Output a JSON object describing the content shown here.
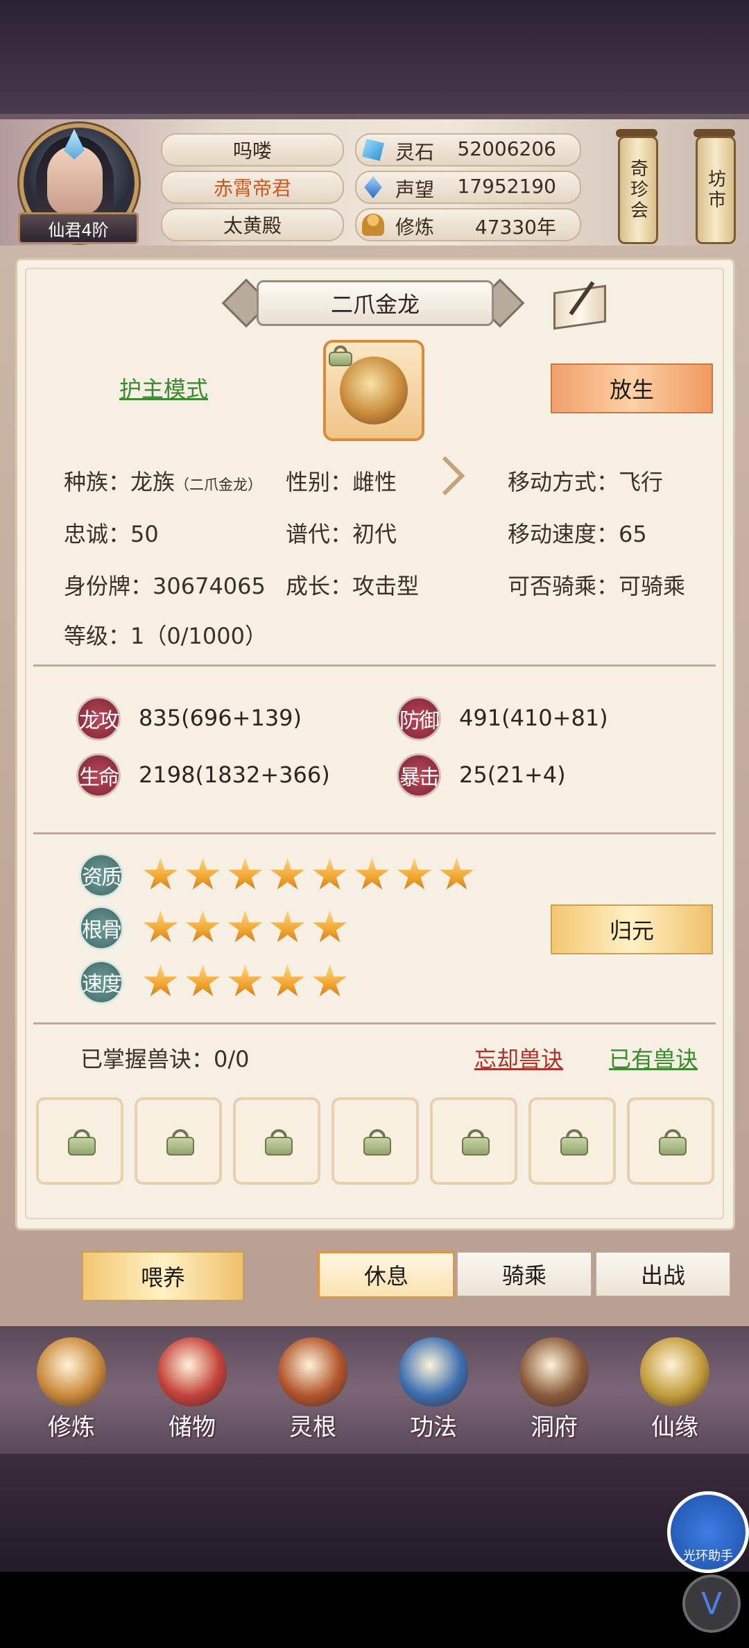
{
  "header": {
    "rank": "仙君4阶",
    "player_name": "吗喽",
    "title": "赤霄帝君",
    "location": "太黄殿",
    "resources": [
      {
        "icon": "spirit-stone-icon",
        "label": "灵石",
        "value": "52006206"
      },
      {
        "icon": "prestige-icon",
        "label": "声望",
        "value": "17952190"
      },
      {
        "icon": "cultivation-icon",
        "label": "修炼",
        "value": "47330年"
      }
    ],
    "side_tags": [
      "奇珍会",
      "坊市"
    ]
  },
  "pet": {
    "name": "二爪金龙",
    "mode_label": "护主模式",
    "release_label": "放生",
    "attrs": {
      "race": "种族：龙族",
      "race_sub": "（二爪金龙）",
      "gender": "性别：雌性",
      "move_type": "移动方式：飞行",
      "loyalty": "忠诚：50",
      "generation": "谱代：初代",
      "move_speed": "移动速度：65",
      "id_tag": "身份牌：30674065",
      "growth": "成长：攻击型",
      "rideable": "可否骑乘：可骑乘",
      "level": "等级：1（0/1000）"
    },
    "stats": [
      {
        "label": "龙攻",
        "value": "835(696+139)"
      },
      {
        "label": "防御",
        "value": "491(410+81)"
      },
      {
        "label": "生命",
        "value": "2198(1832+366)"
      },
      {
        "label": "暴击",
        "value": "25(21+4)"
      }
    ],
    "ratings": [
      {
        "label": "资质",
        "stars": 8
      },
      {
        "label": "根骨",
        "stars": 5
      },
      {
        "label": "速度",
        "stars": 5
      }
    ],
    "reset_label": "归元",
    "skills_label": "已掌握兽诀：0/0",
    "forget_label": "忘却兽诀",
    "owned_label": "已有兽诀",
    "skill_slots": 7
  },
  "actions": {
    "feed": "喂养",
    "rest": "休息",
    "ride": "骑乘",
    "battle": "出战"
  },
  "nav": [
    {
      "label": "修炼",
      "icon": "cultivate-icon",
      "color": "#c9893a"
    },
    {
      "label": "储物",
      "icon": "storage-bag-icon",
      "color": "#c4413a"
    },
    {
      "label": "灵根",
      "icon": "spirit-root-icon",
      "color": "#b2542b"
    },
    {
      "label": "功法",
      "icon": "technique-book-icon",
      "color": "#3b6fb0"
    },
    {
      "label": "洞府",
      "icon": "cave-dwelling-icon",
      "color": "#8a5a3a"
    },
    {
      "label": "仙缘",
      "icon": "immortal-fate-icon",
      "color": "#c29b3a"
    }
  ],
  "overlay": {
    "helper_label": "光环助手",
    "v_glyph": "V"
  }
}
